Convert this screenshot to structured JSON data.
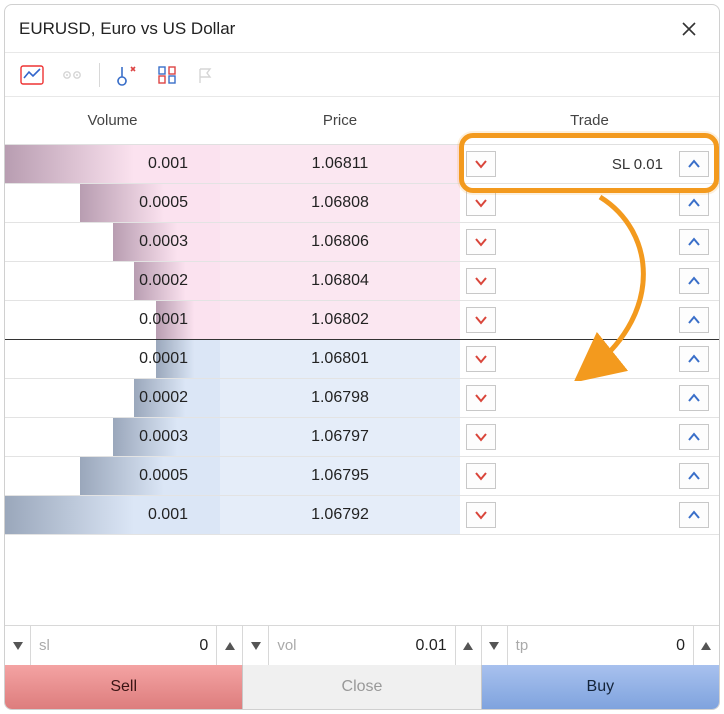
{
  "title": "EURUSD, Euro vs US Dollar",
  "headers": {
    "volume": "Volume",
    "price": "Price",
    "trade": "Trade"
  },
  "rows": [
    {
      "side": "ask",
      "volume": "0.001",
      "price": "1.06811",
      "barPct": 100,
      "sl_label": "SL 0.01"
    },
    {
      "side": "ask",
      "volume": "0.0005",
      "price": "1.06808",
      "barPct": 65
    },
    {
      "side": "ask",
      "volume": "0.0003",
      "price": "1.06806",
      "barPct": 50
    },
    {
      "side": "ask",
      "volume": "0.0002",
      "price": "1.06804",
      "barPct": 40
    },
    {
      "side": "ask",
      "volume": "0.0001",
      "price": "1.06802",
      "barPct": 30
    },
    {
      "side": "bid",
      "volume": "0.0001",
      "price": "1.06801",
      "barPct": 30
    },
    {
      "side": "bid",
      "volume": "0.0002",
      "price": "1.06798",
      "barPct": 40
    },
    {
      "side": "bid",
      "volume": "0.0003",
      "price": "1.06797",
      "barPct": 50
    },
    {
      "side": "bid",
      "volume": "0.0005",
      "price": "1.06795",
      "barPct": 65
    },
    {
      "side": "bid",
      "volume": "0.001",
      "price": "1.06792",
      "barPct": 100
    }
  ],
  "inputs": {
    "sl": {
      "label": "sl",
      "value": "0"
    },
    "vol": {
      "label": "vol",
      "value": "0.01"
    },
    "tp": {
      "label": "tp",
      "value": "0"
    }
  },
  "actions": {
    "sell": "Sell",
    "close": "Close",
    "buy": "Buy"
  },
  "colors": {
    "ask": "#fbe7f1",
    "bid": "#e5edf9",
    "highlight": "#f39a1e"
  }
}
